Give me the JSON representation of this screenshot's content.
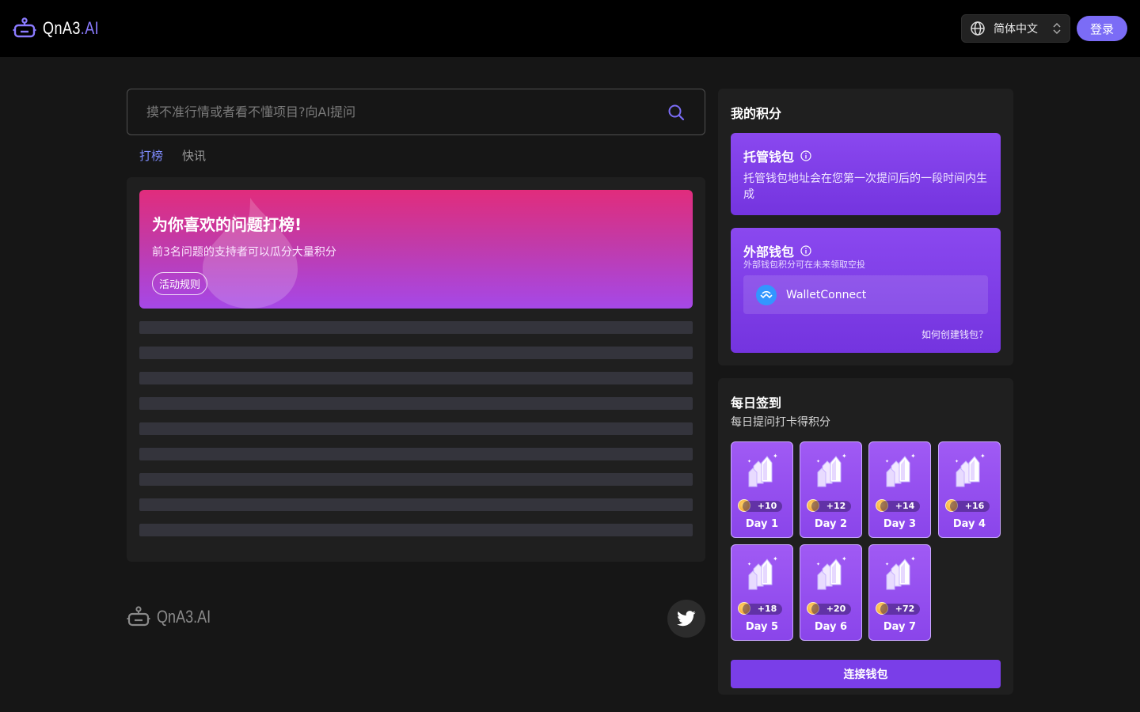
{
  "header": {
    "logo_main": "QnA3",
    "logo_ai": ".AI",
    "language": "简体中文",
    "login_label": "登录"
  },
  "search": {
    "placeholder": "摸不准行情或者看不懂项目?向AI提问"
  },
  "tabs": [
    {
      "label": "打榜",
      "active": true
    },
    {
      "label": "快讯",
      "active": false
    }
  ],
  "banner": {
    "title": "为你喜欢的问题打榜!",
    "subtitle": "前3名问题的支持者可以瓜分大量积分",
    "rules_label": "活动规则"
  },
  "footer": {
    "logo_text": "QnA3.AI"
  },
  "points": {
    "title": "我的积分",
    "custody": {
      "title": "托管钱包",
      "desc": "托管钱包地址会在您第一次提问后的一段时间内生成"
    },
    "external": {
      "title": "外部钱包",
      "desc": "外部钱包积分可在未来领取空投",
      "connect_label": "WalletConnect",
      "how_label": "如何创建钱包？"
    }
  },
  "daily": {
    "title": "每日签到",
    "subtitle": "每日提问打卡得积分",
    "days": [
      {
        "label": "Day 1",
        "reward": "+10"
      },
      {
        "label": "Day 2",
        "reward": "+12"
      },
      {
        "label": "Day 3",
        "reward": "+14"
      },
      {
        "label": "Day 4",
        "reward": "+16"
      },
      {
        "label": "Day 5",
        "reward": "+18"
      },
      {
        "label": "Day 6",
        "reward": "+20"
      },
      {
        "label": "Day 7",
        "reward": "+72"
      }
    ],
    "connect_label": "连接钱包"
  },
  "colors": {
    "accent": "#7b6cf6",
    "card_purple": "#8a48ef",
    "banner_pink": "#e12c7c"
  }
}
